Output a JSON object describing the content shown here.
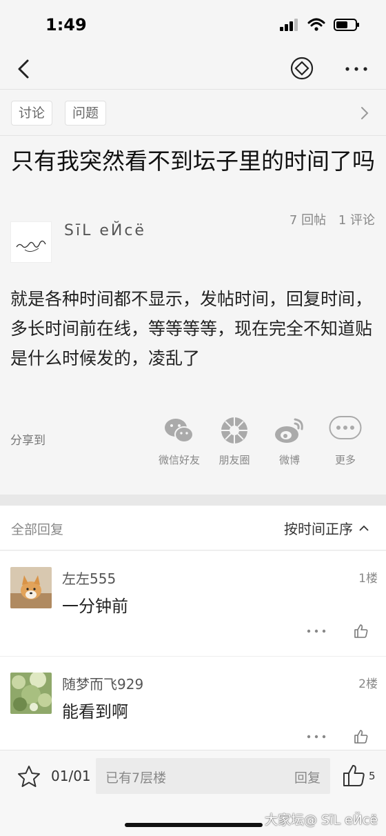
{
  "status_bar": {
    "time": "1:49"
  },
  "nav": {
    "back_icon": "chevron-left-icon",
    "favorite_icon": "diamond-icon",
    "more_icon": "ellipsis-icon"
  },
  "tags": [
    "讨论",
    "问题"
  ],
  "post": {
    "title": "只有我突然看不到坛子里的时间了吗",
    "author": "SīL eЙcë",
    "stats": {
      "replies": "7 回帖",
      "comments": "1 评论"
    },
    "body": "就是各种时间都不显示，发帖时间，回复时间，多长时间前在线，等等等等，现在完全不知道贴是什么时候发的，凌乱了"
  },
  "share": {
    "label": "分享到",
    "items": [
      {
        "label": "微信好友",
        "icon": "wechat-icon"
      },
      {
        "label": "朋友圈",
        "icon": "moments-icon"
      },
      {
        "label": "微博",
        "icon": "weibo-icon"
      },
      {
        "label": "更多",
        "icon": "more-icon"
      }
    ]
  },
  "replies_section": {
    "title": "全部回复",
    "sort_label": "按时间正序",
    "items": [
      {
        "user": "左左555",
        "floor": "1楼",
        "content": "一分钟前"
      },
      {
        "user": "随梦而飞929",
        "floor": "2楼",
        "content": "能看到啊"
      }
    ]
  },
  "bottom_bar": {
    "page": "01/01",
    "placeholder": "已有7层楼",
    "reply_label": "回复",
    "like_count": "5"
  },
  "watermark": "大家坛@ SīL eЙcë",
  "colors": {
    "background": "#f5f5f5",
    "text": "#222222",
    "muted": "#888888"
  }
}
